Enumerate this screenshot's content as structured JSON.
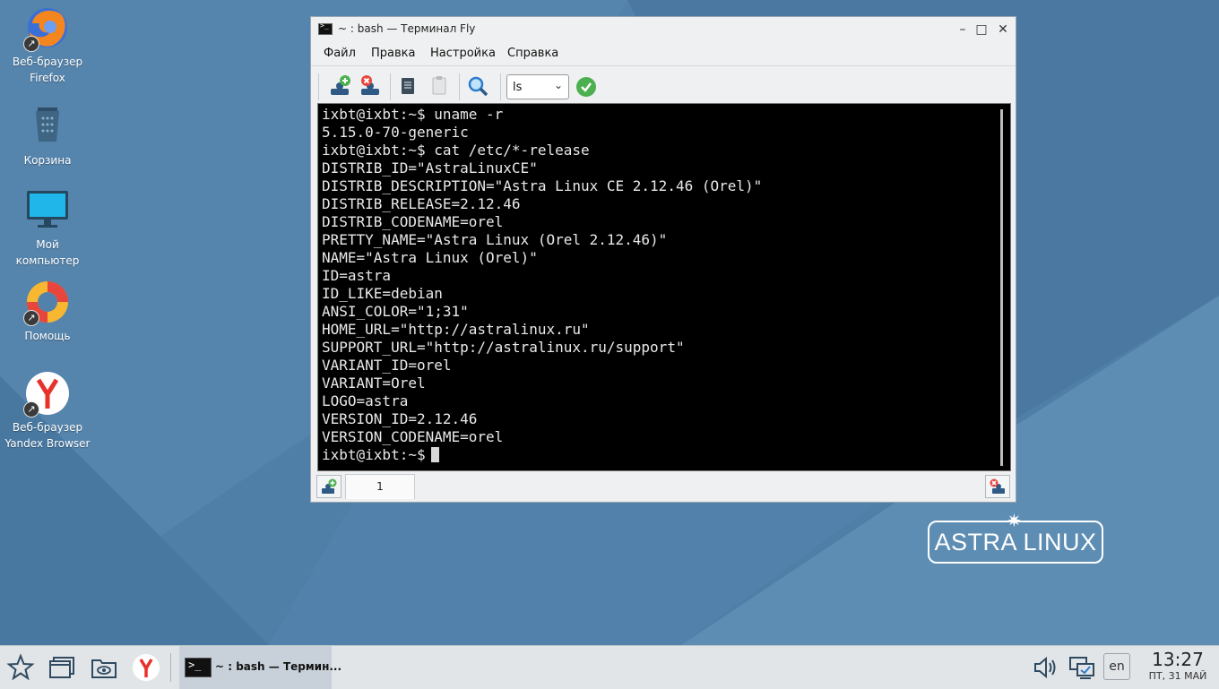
{
  "desktop": {
    "icons": [
      {
        "label": "Веб-браузер\nFirefox"
      },
      {
        "label": "Корзина"
      },
      {
        "label": "Мой\nкомпьютер"
      },
      {
        "label": "Помощь"
      },
      {
        "label": "Веб-браузер\nYandex Browser"
      }
    ],
    "logo_text": "ASTRA LINUX"
  },
  "window": {
    "title": "~ : bash — Терминал Fly",
    "menu": [
      "Файл",
      "Правка",
      "Настройка",
      "Справка"
    ],
    "toolbar": {
      "command_select_value": "ls"
    },
    "terminal": {
      "lines": [
        "ixbt@ixbt:~$ uname -r",
        "5.15.0-70-generic",
        "ixbt@ixbt:~$ cat /etc/*-release",
        "DISTRIB_ID=\"AstraLinuxCE\"",
        "DISTRIB_DESCRIPTION=\"Astra Linux CE 2.12.46 (Orel)\"",
        "DISTRIB_RELEASE=2.12.46",
        "DISTRIB_CODENAME=orel",
        "PRETTY_NAME=\"Astra Linux (Orel 2.12.46)\"",
        "NAME=\"Astra Linux (Orel)\"",
        "ID=astra",
        "ID_LIKE=debian",
        "ANSI_COLOR=\"1;31\"",
        "HOME_URL=\"http://astralinux.ru\"",
        "SUPPORT_URL=\"http://astralinux.ru/support\"",
        "VARIANT_ID=orel",
        "VARIANT=Orel",
        "LOGO=astra",
        "VERSION_ID=2.12.46",
        "VERSION_CODENAME=orel"
      ],
      "prompt": "ixbt@ixbt:~$"
    },
    "tabs": [
      {
        "label": "1"
      }
    ]
  },
  "taskbar": {
    "task_label": "~ : bash — Термин...",
    "language": "en",
    "clock_time": "13:27",
    "clock_date": "ПТ, 31 МАЙ"
  }
}
